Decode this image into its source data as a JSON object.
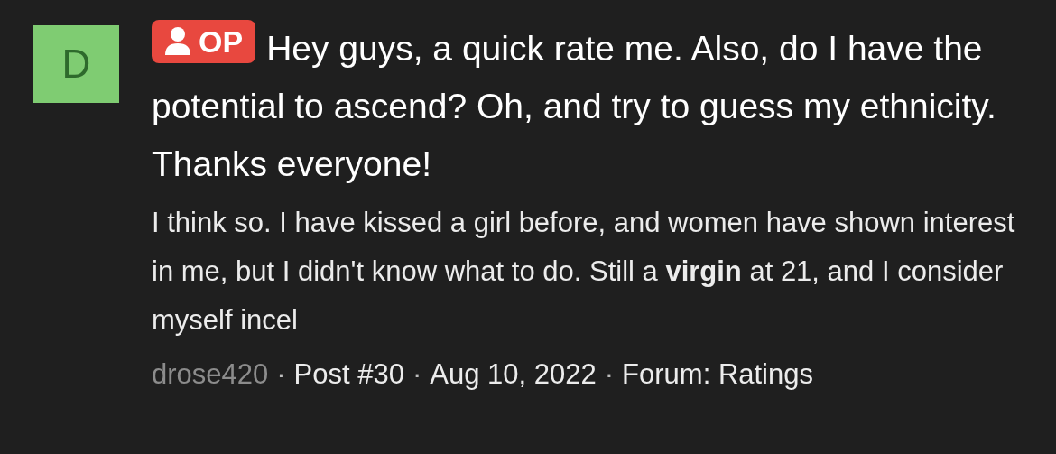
{
  "post": {
    "avatar": {
      "letter": "D",
      "color": "#7fcc72"
    },
    "badge": {
      "label": "OP"
    },
    "title": "Hey guys, a quick rate me. Also, do I have the potential to ascend? Oh, and try to guess my ethnicity. Thanks everyone!",
    "body": "I think so. I have kissed a girl before, and women have shown interest in me, but I didn't know what to do. Still a **virgin** at 21, and I consider myself incel",
    "meta": [
      {
        "kind": "author",
        "text": "drose420"
      },
      {
        "kind": "separator",
        "text": "·"
      },
      {
        "kind": "info",
        "text": "Post #30"
      },
      {
        "kind": "separator",
        "text": "·"
      },
      {
        "kind": "info",
        "text": "Aug 10, 2022"
      },
      {
        "kind": "separator",
        "text": "·"
      },
      {
        "kind": "info",
        "text": "Forum: Ratings"
      }
    ]
  }
}
